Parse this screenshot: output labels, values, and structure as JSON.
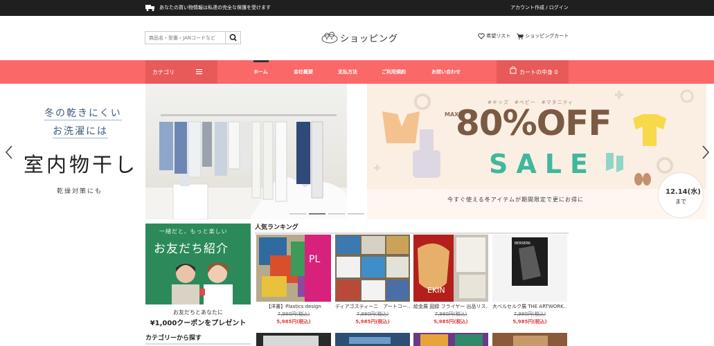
{
  "topbar": {
    "notice": "あなたの買い物情報は私達の完全な保護を受けます",
    "account": "アカウント作成 / ログイン"
  },
  "header": {
    "search_placeholder": "商品名・型番・JANコードなど",
    "logo_text": "ショッピング",
    "wishlist": "希望リスト",
    "cart": "ショッピングカート"
  },
  "nav": {
    "category": "カテゴリ",
    "items": [
      "ホーム",
      "会社概要",
      "支払方法",
      "ご利用規約",
      "お問い合わせ"
    ],
    "cart": "カートの中身 0"
  },
  "banner": {
    "left": {
      "line1": "冬の乾きにくい",
      "line2": "お洗濯には",
      "line3": "室内物干し",
      "line4": "乾燥対策にも"
    },
    "right": {
      "tags": "#キッズ　#ベビー　#マタニティ",
      "max": "MAX",
      "off": "80%OFF",
      "sale": "SALE",
      "footer": "今すぐ使える冬アイテムが期間限定で更にお得に",
      "date": "12.14(水)",
      "until": "まで"
    }
  },
  "promo": {
    "small": "一緒だと、もっと楽しい",
    "title": "お友だち紹介",
    "caption1": "お友だちとあなたに",
    "caption2": "¥1,000クーポンをプレゼント"
  },
  "sections": {
    "category_browse": "カテゴリーから探す",
    "ranking": "人気ランキング"
  },
  "products": [
    {
      "name": "【洋書】Plastics design",
      "old_price": "7,980円(税込)",
      "price": "5,985円(税込)"
    },
    {
      "name": "ディアゴスティーニ　アートコー…",
      "old_price": "7,980円(税込)",
      "price": "5,985円(税込)"
    },
    {
      "name": "絵金展 図録 フライヤー 出品リス…",
      "old_price": "7,980円(税込)",
      "price": "5,985円(税込)"
    },
    {
      "name": "大ベルセルク展 THE ARTWORK…",
      "old_price": "7,980円(税込)",
      "price": "5,985円(税込)"
    }
  ],
  "colors": {
    "nav": "#fb6868",
    "nav_dark": "#e85a5a",
    "topbar": "#1f1f1f",
    "price": "#e23b3b",
    "sale_green": "#3fb89c",
    "off_brown": "#7b5a44"
  }
}
